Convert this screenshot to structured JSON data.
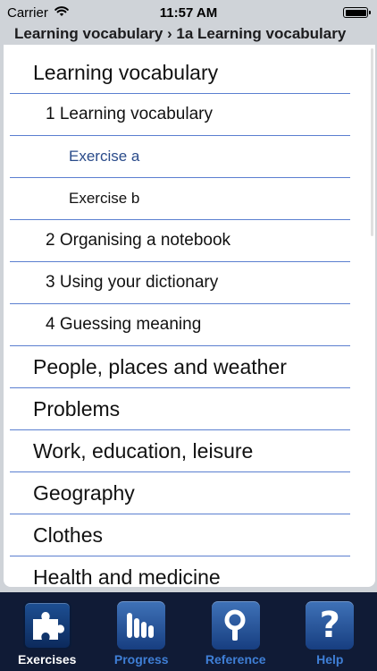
{
  "status_bar": {
    "carrier": "Carrier",
    "time": "11:57 AM",
    "wifi_icon": "wifi-icon",
    "battery_icon": "battery-icon"
  },
  "breadcrumb": "Learning vocabulary › 1a Learning vocabulary",
  "list": [
    {
      "label": "Learning vocabulary",
      "level": 1
    },
    {
      "label": "1 Learning vocabulary",
      "level": 2
    },
    {
      "label": "Exercise a",
      "level": 3,
      "active": true
    },
    {
      "label": "Exercise b",
      "level": 3
    },
    {
      "label": "2 Organising a notebook",
      "level": 2
    },
    {
      "label": "3 Using your dictionary",
      "level": 2
    },
    {
      "label": "4 Guessing meaning",
      "level": 2
    },
    {
      "label": "People, places and weather",
      "level": 1
    },
    {
      "label": "Problems",
      "level": 1
    },
    {
      "label": "Work, education, leisure",
      "level": 1
    },
    {
      "label": "Geography",
      "level": 1
    },
    {
      "label": "Clothes",
      "level": 1
    },
    {
      "label": "Health and medicine",
      "level": 1
    }
  ],
  "tabs": [
    {
      "label": "Exercises",
      "icon": "puzzle-icon",
      "selected": true
    },
    {
      "label": "Progress",
      "icon": "bar-chart-icon"
    },
    {
      "label": "Reference",
      "icon": "magnifier-icon"
    },
    {
      "label": "Help",
      "icon": "question-icon"
    }
  ],
  "colors": {
    "accent": "#5b7fd0",
    "active_text": "#2a4b8a",
    "tabbar_bg": "#101b36",
    "tab_label": "#3f7fd6"
  }
}
